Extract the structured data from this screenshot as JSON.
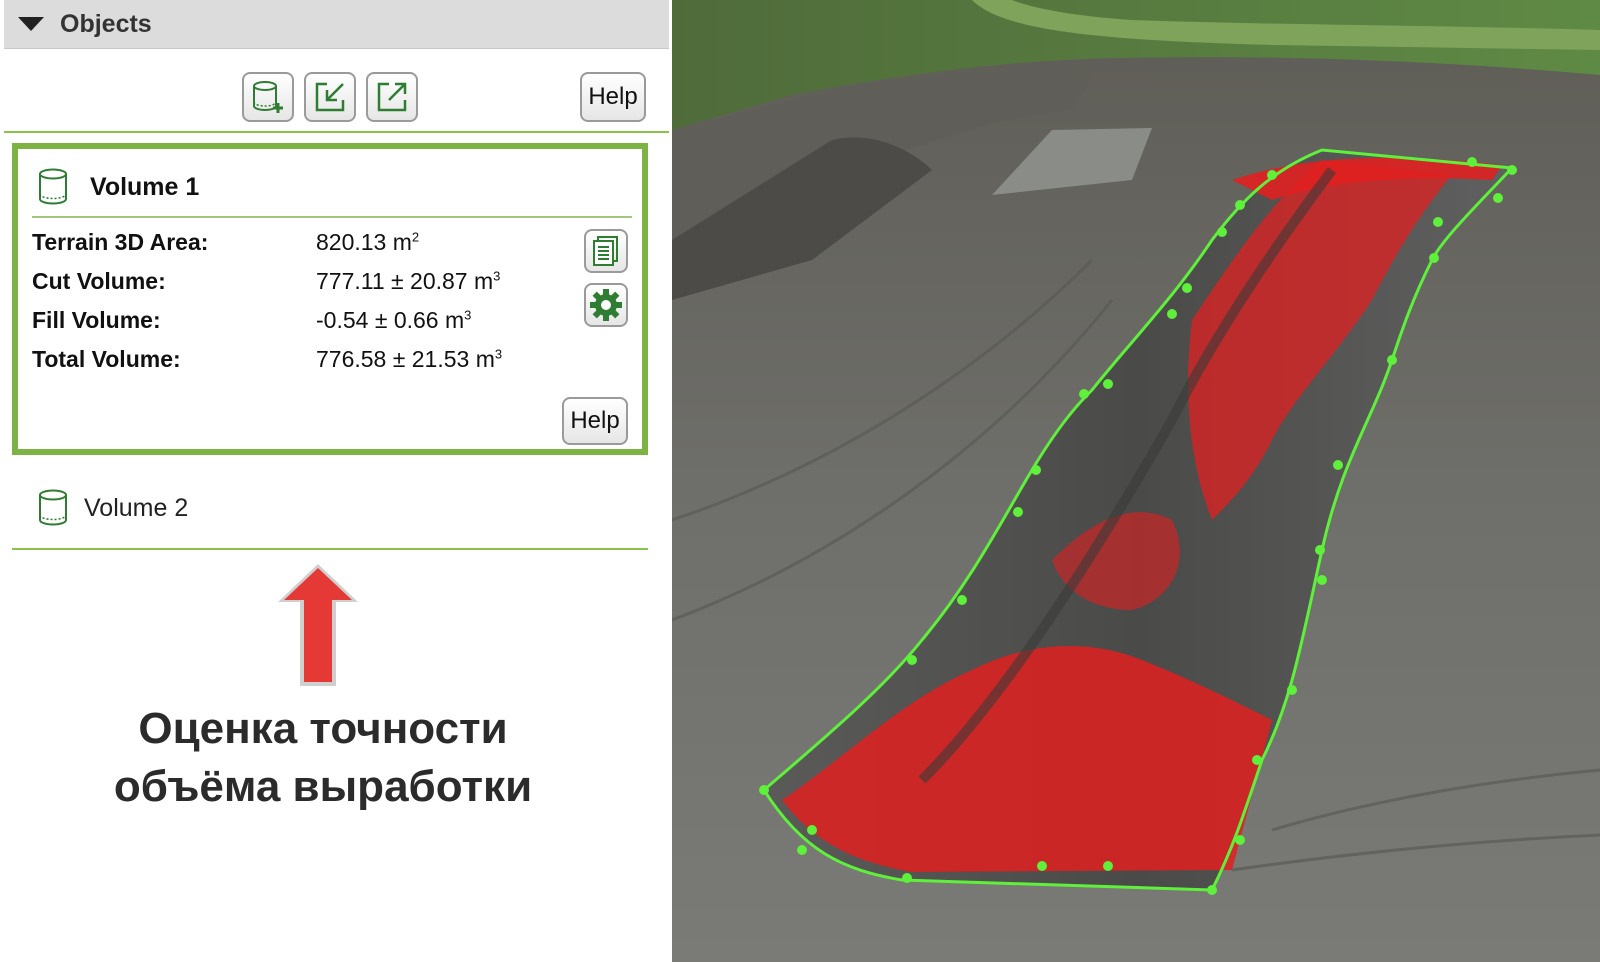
{
  "panel": {
    "title": "Objects",
    "toolbar": {
      "buttons": [
        {
          "icon": "new-volume-icon"
        },
        {
          "icon": "import-icon"
        },
        {
          "icon": "export-icon"
        }
      ],
      "help_label": "Help"
    }
  },
  "volume1": {
    "title": "Volume 1",
    "stats": [
      {
        "label": "Terrain 3D Area:",
        "value": "820.13 m",
        "unit_exp": "2"
      },
      {
        "label": "Cut Volume:",
        "value": "777.11 ± 20.87 m",
        "unit_exp": "3"
      },
      {
        "label": "Fill Volume:",
        "value": "-0.54 ± 0.66 m",
        "unit_exp": "3"
      },
      {
        "label": "Total Volume:",
        "value": "776.58 ± 21.53 m",
        "unit_exp": "3"
      }
    ],
    "help_label": "Help",
    "report_icon": "report-icon",
    "settings_icon": "gear-icon"
  },
  "volume2": {
    "title": "Volume 2"
  },
  "caption": {
    "line1": "Оценка точности",
    "line2": "объёма выработки"
  },
  "colors": {
    "accent_green": "#7cb342",
    "arrow_red": "#e53935",
    "cut_red": "#e02020",
    "boundary_green": "#5ef03a"
  }
}
